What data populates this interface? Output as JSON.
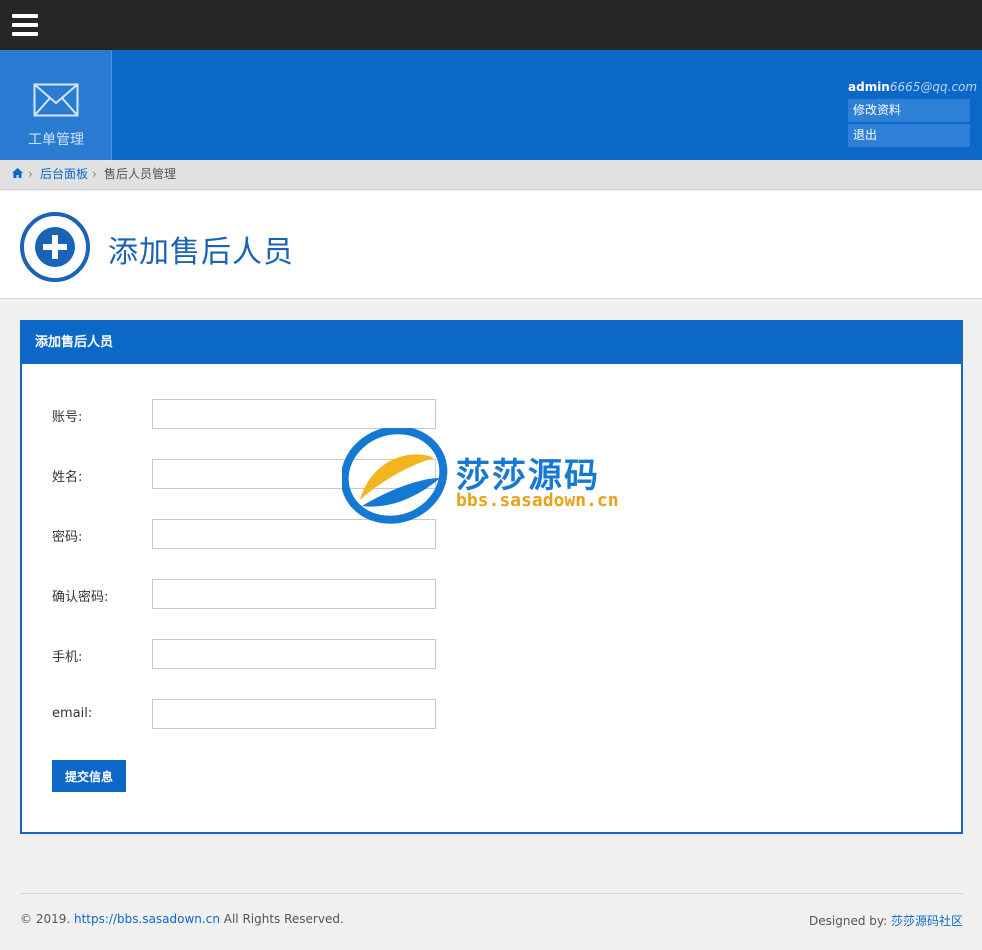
{
  "topbar": {
    "menu_icon": "hamburger-menu-icon"
  },
  "header": {
    "module": {
      "label": "工单管理",
      "icon": "envelope-icon"
    },
    "user": {
      "name": "admin",
      "email": "6665@qq.com",
      "menu": [
        {
          "label": "修改资料"
        },
        {
          "label": "退出"
        }
      ]
    }
  },
  "breadcrumb": {
    "home_icon": "home-icon",
    "items": [
      {
        "label": "后台面板"
      },
      {
        "label": "售后人员管理"
      }
    ]
  },
  "page": {
    "title": "添加售后人员",
    "title_icon": "plus-circle-icon"
  },
  "panel": {
    "title": "添加售后人员",
    "fields": [
      {
        "label": "账号:",
        "value": ""
      },
      {
        "label": "姓名:",
        "value": ""
      },
      {
        "label": "密码:",
        "value": ""
      },
      {
        "label": "确认密码:",
        "value": ""
      },
      {
        "label": "手机:",
        "value": ""
      },
      {
        "label": "email:",
        "value": ""
      }
    ],
    "submit_label": "提交信息"
  },
  "watermark": {
    "title": "莎莎源码",
    "subtitle": "bbs.sasadown.cn"
  },
  "footer": {
    "copyright_prefix": "© 2019.",
    "link": "https://bbs.sasadown.cn",
    "copyright_suffix": "All Rights Reserved.",
    "designed_by": "Designed by:",
    "designer": "莎莎源码社区"
  },
  "colors": {
    "topbar": "#262626",
    "brand_blue": "#0c68c8",
    "page_bg": "#f0f0f0"
  }
}
